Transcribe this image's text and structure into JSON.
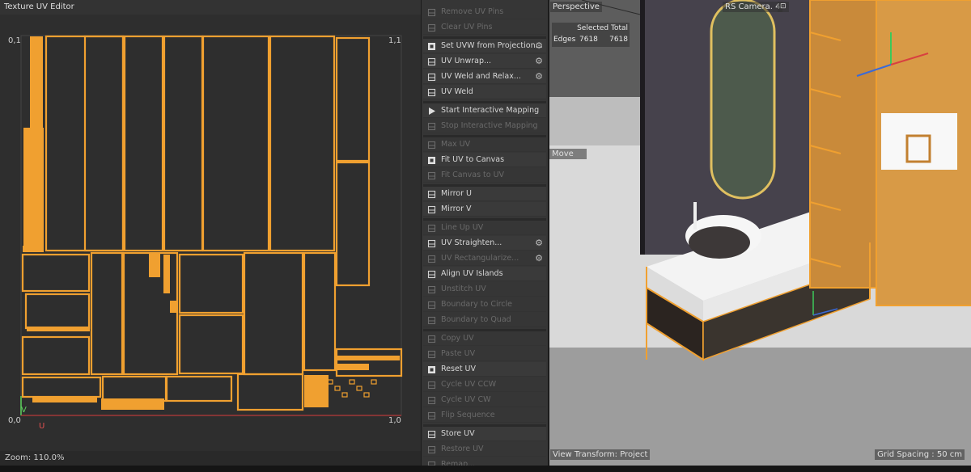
{
  "uv_editor": {
    "title": "Texture UV Editor",
    "zoom": "Zoom: 110.0%",
    "corner_top_left": "0,1",
    "corner_top_right": "1,1",
    "corner_bottom_left": "0,0",
    "corner_bottom_right": "1,0",
    "axis_v": "V",
    "axis_u": "U",
    "island_color": "#f0a030"
  },
  "commands": [
    {
      "label": "Remove UV Pins",
      "icon": "pin-icon",
      "enabled": false,
      "gear": false
    },
    {
      "label": "Clear UV Pins",
      "icon": "pin-clear-icon",
      "enabled": false,
      "gear": false
    },
    {
      "label": "Set UVW from Projection...",
      "icon": "projection-icon",
      "enabled": true,
      "gear": true
    },
    {
      "label": "UV Unwrap...",
      "icon": "unwrap-icon",
      "enabled": true,
      "gear": true
    },
    {
      "label": "UV Weld and Relax...",
      "icon": "weld-relax-icon",
      "enabled": true,
      "gear": true
    },
    {
      "label": "UV Weld",
      "icon": "weld-icon",
      "enabled": true,
      "gear": false
    },
    {
      "label": "Start Interactive Mapping",
      "icon": "play-icon",
      "enabled": true,
      "gear": false
    },
    {
      "label": "Stop Interactive Mapping",
      "icon": "stop-icon",
      "enabled": false,
      "gear": false
    },
    {
      "label": "Max UV",
      "icon": "max-uv-icon",
      "enabled": false,
      "gear": false
    },
    {
      "label": "Fit UV to Canvas",
      "icon": "fit-canvas-icon",
      "enabled": true,
      "gear": false
    },
    {
      "label": "Fit Canvas to UV",
      "icon": "fit-uv-icon",
      "enabled": false,
      "gear": false
    },
    {
      "label": "Mirror U",
      "icon": "mirror-u-icon",
      "enabled": true,
      "gear": false
    },
    {
      "label": "Mirror V",
      "icon": "mirror-v-icon",
      "enabled": true,
      "gear": false
    },
    {
      "label": "Line Up UV",
      "icon": "line-up-icon",
      "enabled": false,
      "gear": false
    },
    {
      "label": "UV Straighten...",
      "icon": "straighten-icon",
      "enabled": true,
      "gear": true
    },
    {
      "label": "UV Rectangularize...",
      "icon": "rectangularize-icon",
      "enabled": false,
      "gear": true
    },
    {
      "label": "Align UV Islands",
      "icon": "align-icon",
      "enabled": true,
      "gear": false
    },
    {
      "label": "Unstitch UV",
      "icon": "unstitch-icon",
      "enabled": false,
      "gear": false
    },
    {
      "label": "Boundary to Circle",
      "icon": "circle-icon",
      "enabled": false,
      "gear": false
    },
    {
      "label": "Boundary to Quad",
      "icon": "quad-icon",
      "enabled": false,
      "gear": false
    },
    {
      "label": "Copy UV",
      "icon": "copy-icon",
      "enabled": false,
      "gear": false
    },
    {
      "label": "Paste UV",
      "icon": "paste-icon",
      "enabled": false,
      "gear": false
    },
    {
      "label": "Reset UV",
      "icon": "reset-icon",
      "enabled": true,
      "gear": false
    },
    {
      "label": "Cycle UV CCW",
      "icon": "cycle-ccw-icon",
      "enabled": false,
      "gear": false
    },
    {
      "label": "Cycle UV CW",
      "icon": "cycle-cw-icon",
      "enabled": false,
      "gear": false
    },
    {
      "label": "Flip Sequence",
      "icon": "flip-icon",
      "enabled": false,
      "gear": false
    },
    {
      "label": "Store UV",
      "icon": "store-icon",
      "enabled": true,
      "gear": false
    },
    {
      "label": "Restore UV",
      "icon": "restore-icon",
      "enabled": false,
      "gear": false
    },
    {
      "label": "Remap...",
      "icon": "remap-icon",
      "enabled": false,
      "gear": false
    }
  ],
  "viewport": {
    "view_name": "Perspective",
    "camera": "RS Camera. 4",
    "hud_header": "Selected Total",
    "hud_row_label": "Edges",
    "hud_selected": "7618",
    "hud_total": "7618",
    "move_label": "Move",
    "view_transform": "View Transform: Project",
    "grid_spacing": "Grid Spacing : 50 cm",
    "wireframe_color": "#f0a030"
  }
}
